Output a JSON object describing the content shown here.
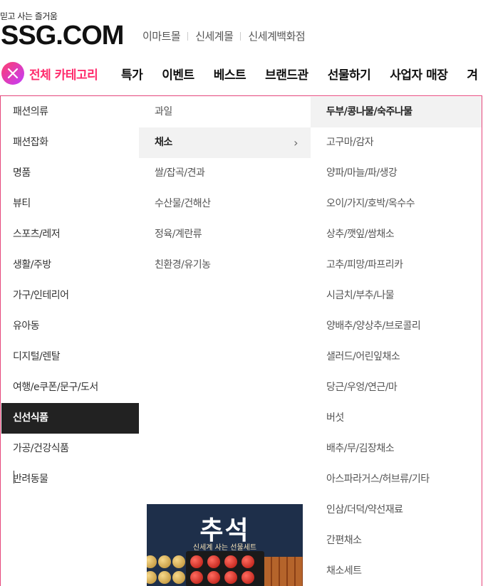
{
  "header": {
    "tagline": "믿고 사는 즐거움",
    "logo": "SSG.COM",
    "affiliates": [
      "이마트몰",
      "신세계몰",
      "신세계백화점"
    ]
  },
  "gnb": {
    "all_category": "전체 카테고리",
    "menu": [
      "특가",
      "이벤트",
      "베스트",
      "브랜드관",
      "선물하기",
      "사업자 매장",
      "겨"
    ]
  },
  "categories": {
    "level1": [
      "패션의류",
      "패션잡화",
      "명품",
      "뷰티",
      "스포츠/레저",
      "생활/주방",
      "가구/인테리어",
      "유아동",
      "디지털/렌탈",
      "여행/e쿠폰/문구/도서",
      "신선식품",
      "가공/건강식품",
      "반려동물"
    ],
    "level1_active": "신선식품",
    "level2": [
      "과일",
      "채소",
      "쌀/잡곡/견과",
      "수산물/건해산",
      "정육/계란류",
      "친환경/유기농"
    ],
    "level2_selected": "채소",
    "level3": [
      "두부/콩나물/숙주나물",
      "고구마/감자",
      "양파/마늘/파/생강",
      "오이/가지/호박/옥수수",
      "상추/깻잎/쌈채소",
      "고추/피망/파프리카",
      "시금치/부추/나물",
      "양배추/양상추/브로콜리",
      "샐러드/어린잎채소",
      "당근/우엉/연근/마",
      "버섯",
      "배추/무/김장채소",
      "아스파라거스/허브류/기타",
      "인삼/더덕/약선재료",
      "간편채소",
      "채소세트"
    ],
    "level3_highlight": "두부/콩나물/숙주나물"
  },
  "banner": {
    "title": "추석",
    "subtitle": "신세계 사는 선물세트"
  },
  "colors": {
    "accent": "#ff2c6d",
    "active_bg": "#222222",
    "selected_bg": "#f2f2f2",
    "border": "#e5477c"
  },
  "icons": {
    "close": "close-icon",
    "chevron": "chevron-right-icon"
  }
}
